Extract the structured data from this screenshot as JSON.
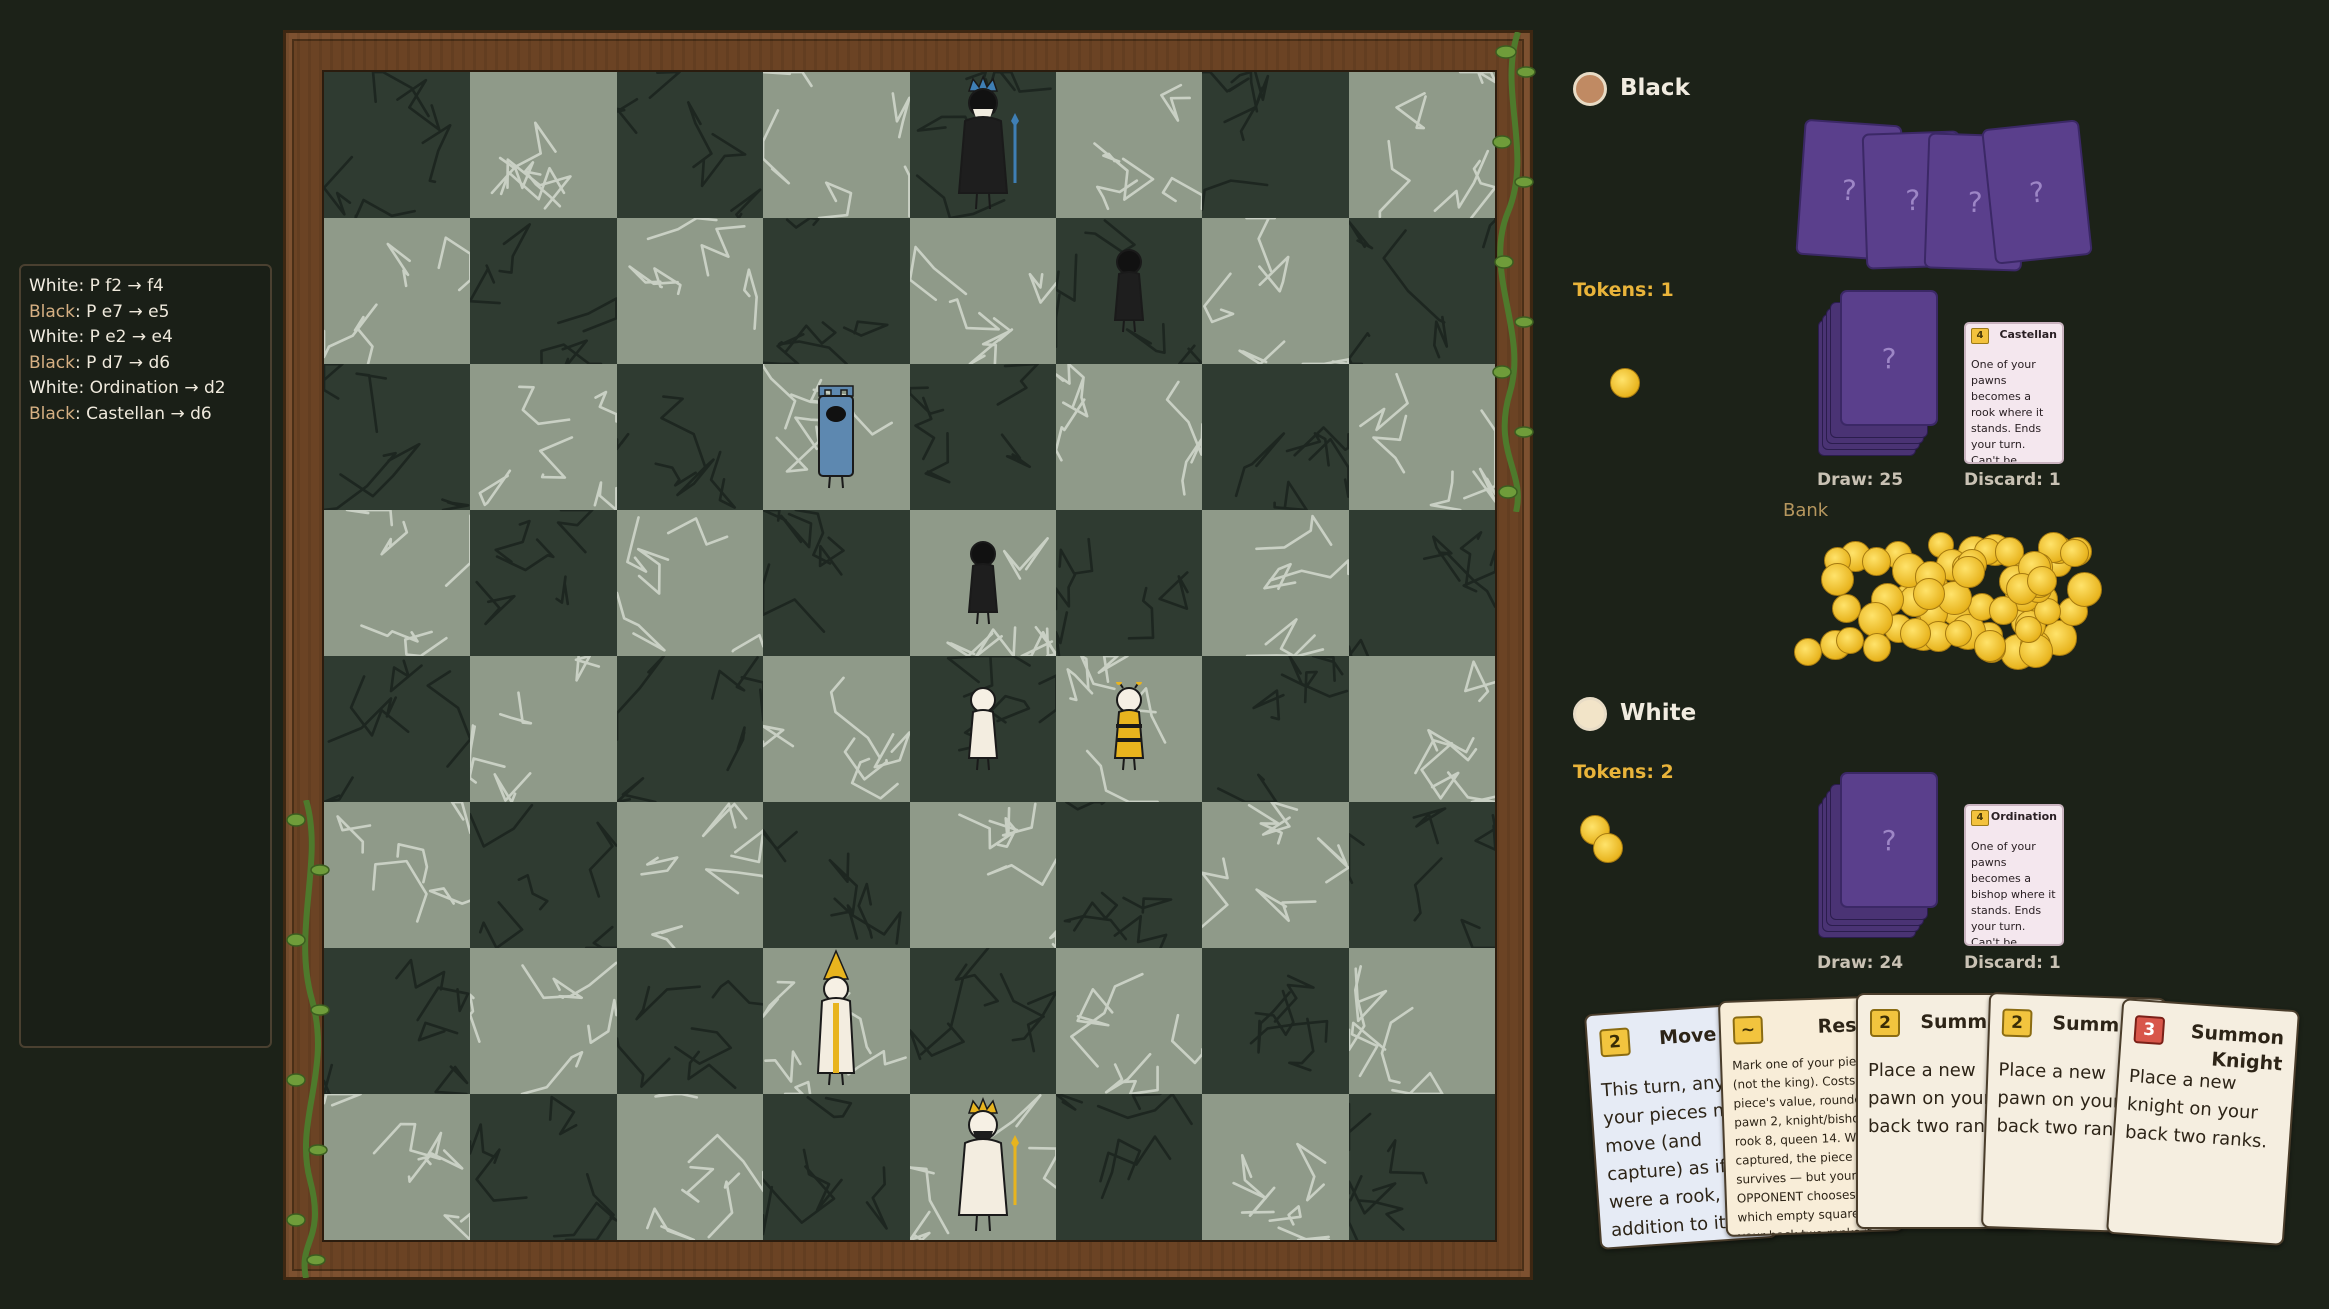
{
  "move_log": [
    {
      "player": "White",
      "text": ": P f2 → f4"
    },
    {
      "player": "Black",
      "text": ": P e7 → e5"
    },
    {
      "player": "White",
      "text": ": P e2 → e4"
    },
    {
      "player": "Black",
      "text": ": P d7 → d6"
    },
    {
      "player": "White",
      "text": ": Ordination → d2"
    },
    {
      "player": "Black",
      "text": ": Castellan → d6"
    }
  ],
  "black": {
    "name": "Black",
    "tokens": "Tokens: 1",
    "draw": "Draw: 25",
    "discard": "Discard: 1",
    "hidden_hand": [
      "?",
      "?",
      "?",
      "?"
    ],
    "deck_back": "?",
    "discard_card": {
      "cost": "4",
      "title": "Castellan",
      "text": "One of your pawns becomes a rook where it stands. Ends your turn. Can't be played while in check."
    }
  },
  "bank": {
    "label": "Bank"
  },
  "white": {
    "name": "White",
    "tokens": "Tokens: 2",
    "draw": "Draw: 24",
    "discard": "Discard: 1",
    "deck_back": "?",
    "discard_card": {
      "cost": "4",
      "title": "Ordination",
      "text": "One of your pawns becomes a bishop where it stands. Ends your turn. Can't be played while in check."
    }
  },
  "hand": [
    {
      "cost": "2",
      "title": "Move Ca",
      "text": "This turn, any of your pieces may move (and capture) as if it were a rook, in addition to its normal moves. Your king and queen are unaffected."
    },
    {
      "cost": "~",
      "title": "Respa",
      "text": "Mark one of your pieces (not the king). Costs 1.5x piece's value, rounded: pawn 2, knight/bishop 5, rook 8, queen 14. When captured, the piece survives — but your OPPONENT chooses which empty square on your back two ranks it returns to."
    },
    {
      "cost": "2",
      "title": "Summ Pa",
      "text": "Place a new pawn on your back two ranks."
    },
    {
      "cost": "2",
      "title": "Summ Pa",
      "text": "Place a new pawn on your back two ranks."
    },
    {
      "cost": "3",
      "title": "Summon Knight",
      "text": "Place a new knight on your back two ranks."
    }
  ],
  "colors": {
    "board_light": "#8f9a89",
    "board_dark": "#2f3b31",
    "frame": "#6b4324",
    "token": "#e8b41e",
    "card_back": "#5a3f8c",
    "black_player": "#c08a63",
    "white_player": "#f2e4c8"
  },
  "pieces": [
    {
      "square": "e8",
      "type": "king",
      "color": "black"
    },
    {
      "square": "f7",
      "type": "pawn",
      "color": "black"
    },
    {
      "square": "d6",
      "type": "rook",
      "color": "black"
    },
    {
      "square": "e5",
      "type": "pawn",
      "color": "black"
    },
    {
      "square": "e4",
      "type": "pawn",
      "color": "white"
    },
    {
      "square": "f4",
      "type": "pawn",
      "color": "white"
    },
    {
      "square": "d2",
      "type": "bishop",
      "color": "white"
    },
    {
      "square": "e1",
      "type": "king",
      "color": "white"
    }
  ]
}
